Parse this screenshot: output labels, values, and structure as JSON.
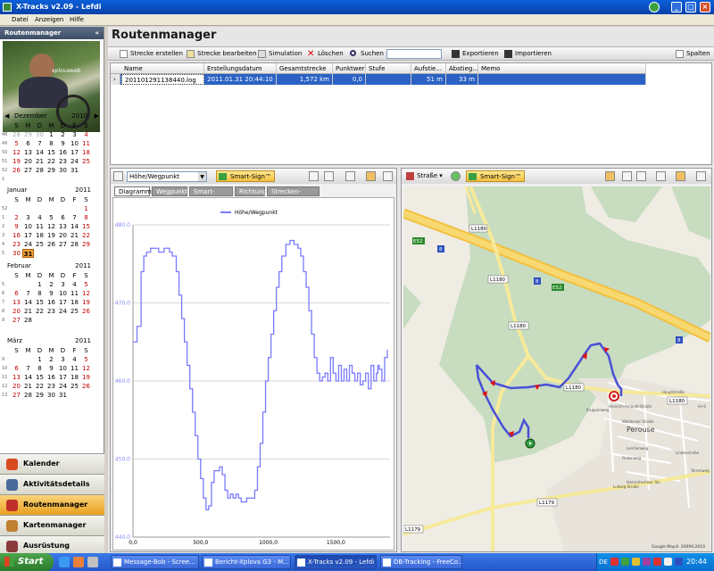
{
  "window": {
    "title": "X-Tracks v2.09 - Lefdi"
  },
  "menu": [
    "Datei",
    "Anzeigen",
    "Hilfe"
  ],
  "sidebar": {
    "title": "Routenmanager",
    "collapse": "«",
    "photo_caption": "xplovaweb",
    "weekday_headers": [
      "S",
      "M",
      "D",
      "M",
      "D",
      "F",
      "S"
    ],
    "calendars": [
      {
        "month": "Dezember",
        "year": "2010",
        "nav": true,
        "weeks": [
          "48",
          "49",
          "50",
          "51",
          "52",
          "1"
        ],
        "days": [
          [
            "28",
            "gray"
          ],
          [
            "29",
            "gray"
          ],
          [
            "30",
            "gray"
          ],
          [
            "1",
            ""
          ],
          [
            "2",
            ""
          ],
          [
            "3",
            ""
          ],
          [
            "4",
            "red"
          ],
          [
            "5",
            "red"
          ],
          [
            "6",
            ""
          ],
          [
            "7",
            ""
          ],
          [
            "8",
            ""
          ],
          [
            "9",
            ""
          ],
          [
            "10",
            ""
          ],
          [
            "11",
            "red"
          ],
          [
            "12",
            "red"
          ],
          [
            "13",
            ""
          ],
          [
            "14",
            ""
          ],
          [
            "15",
            ""
          ],
          [
            "16",
            ""
          ],
          [
            "17",
            ""
          ],
          [
            "18",
            "red"
          ],
          [
            "19",
            "red"
          ],
          [
            "20",
            ""
          ],
          [
            "21",
            ""
          ],
          [
            "22",
            ""
          ],
          [
            "23",
            ""
          ],
          [
            "24",
            ""
          ],
          [
            "25",
            "red"
          ],
          [
            "26",
            "red"
          ],
          [
            "27",
            ""
          ],
          [
            "28",
            ""
          ],
          [
            "29",
            ""
          ],
          [
            "30",
            ""
          ],
          [
            "31",
            ""
          ],
          [
            "",
            ""
          ]
        ]
      },
      {
        "month": "Januar",
        "year": "2011",
        "nav": false,
        "weeks": [
          "52",
          "1",
          "2",
          "3",
          "4",
          "5"
        ],
        "days": [
          [
            "",
            ""
          ],
          [
            "",
            ""
          ],
          [
            "",
            ""
          ],
          [
            "",
            ""
          ],
          [
            "",
            ""
          ],
          [
            "",
            ""
          ],
          [
            "1",
            "red"
          ],
          [
            "2",
            "red"
          ],
          [
            "3",
            ""
          ],
          [
            "4",
            ""
          ],
          [
            "5",
            ""
          ],
          [
            "6",
            ""
          ],
          [
            "7",
            ""
          ],
          [
            "8",
            "red"
          ],
          [
            "9",
            "red"
          ],
          [
            "10",
            ""
          ],
          [
            "11",
            ""
          ],
          [
            "12",
            ""
          ],
          [
            "13",
            ""
          ],
          [
            "14",
            ""
          ],
          [
            "15",
            "red"
          ],
          [
            "16",
            "red"
          ],
          [
            "17",
            ""
          ],
          [
            "18",
            ""
          ],
          [
            "19",
            ""
          ],
          [
            "20",
            ""
          ],
          [
            "21",
            ""
          ],
          [
            "22",
            "red"
          ],
          [
            "23",
            "red"
          ],
          [
            "24",
            ""
          ],
          [
            "25",
            ""
          ],
          [
            "26",
            ""
          ],
          [
            "27",
            ""
          ],
          [
            "28",
            ""
          ],
          [
            "29",
            "red"
          ],
          [
            "30",
            "red"
          ],
          [
            "31",
            "today"
          ],
          [
            "",
            ""
          ],
          [
            "",
            ""
          ],
          [
            "",
            ""
          ],
          [
            "",
            ""
          ],
          [
            "",
            ""
          ]
        ]
      },
      {
        "month": "Februar",
        "year": "2011",
        "nav": false,
        "weeks": [
          "5",
          "6",
          "7",
          "8",
          "9"
        ],
        "days": [
          [
            "",
            ""
          ],
          [
            "",
            ""
          ],
          [
            "1",
            ""
          ],
          [
            "2",
            ""
          ],
          [
            "3",
            ""
          ],
          [
            "4",
            ""
          ],
          [
            "5",
            "red"
          ],
          [
            "6",
            "red"
          ],
          [
            "7",
            ""
          ],
          [
            "8",
            ""
          ],
          [
            "9",
            ""
          ],
          [
            "10",
            ""
          ],
          [
            "11",
            ""
          ],
          [
            "12",
            "red"
          ],
          [
            "13",
            "red"
          ],
          [
            "14",
            ""
          ],
          [
            "15",
            ""
          ],
          [
            "16",
            ""
          ],
          [
            "17",
            ""
          ],
          [
            "18",
            ""
          ],
          [
            "19",
            "red"
          ],
          [
            "20",
            "red"
          ],
          [
            "21",
            ""
          ],
          [
            "22",
            ""
          ],
          [
            "23",
            ""
          ],
          [
            "24",
            ""
          ],
          [
            "25",
            ""
          ],
          [
            "26",
            "red"
          ],
          [
            "27",
            "red"
          ],
          [
            "28",
            ""
          ],
          [
            "",
            ""
          ],
          [
            "",
            ""
          ],
          [
            "",
            ""
          ],
          [
            "",
            ""
          ],
          [
            "",
            ""
          ]
        ]
      },
      {
        "month": "März",
        "year": "2011",
        "nav": false,
        "weeks": [
          "9",
          "10",
          "11",
          "12",
          "13"
        ],
        "days": [
          [
            "",
            ""
          ],
          [
            "",
            ""
          ],
          [
            "1",
            ""
          ],
          [
            "2",
            ""
          ],
          [
            "3",
            ""
          ],
          [
            "4",
            ""
          ],
          [
            "5",
            "red"
          ],
          [
            "6",
            "red"
          ],
          [
            "7",
            ""
          ],
          [
            "8",
            ""
          ],
          [
            "9",
            ""
          ],
          [
            "10",
            ""
          ],
          [
            "11",
            ""
          ],
          [
            "12",
            "red"
          ],
          [
            "13",
            "red"
          ],
          [
            "14",
            ""
          ],
          [
            "15",
            ""
          ],
          [
            "16",
            ""
          ],
          [
            "17",
            ""
          ],
          [
            "18",
            ""
          ],
          [
            "19",
            "red"
          ],
          [
            "20",
            "red"
          ],
          [
            "21",
            ""
          ],
          [
            "22",
            ""
          ],
          [
            "23",
            ""
          ],
          [
            "24",
            ""
          ],
          [
            "25",
            ""
          ],
          [
            "26",
            "red"
          ],
          [
            "27",
            "red"
          ],
          [
            "28",
            ""
          ],
          [
            "29",
            ""
          ],
          [
            "30",
            ""
          ],
          [
            "31",
            ""
          ],
          [
            "",
            ""
          ],
          [
            "",
            ""
          ]
        ]
      }
    ],
    "nav": [
      {
        "label": "Kalender",
        "icon": "calendar-icon",
        "color": "#d84a20"
      },
      {
        "label": "Aktivitätsdetails",
        "icon": "activity-icon",
        "color": "#4a6a9a"
      },
      {
        "label": "Routenmanager",
        "icon": "route-icon",
        "color": "#c0302a",
        "active": true
      },
      {
        "label": "Kartenmanager",
        "icon": "map-icon",
        "color": "#c08030"
      },
      {
        "label": "Ausrüstung",
        "icon": "equipment-icon",
        "color": "#8a3a3a"
      }
    ]
  },
  "main": {
    "title": "Routenmanager",
    "toolbar": {
      "create": "Strecke erstellen",
      "edit": "Strecke bearbeiten",
      "simulation": "Simulation",
      "delete": "Löschen",
      "search": "Suchen",
      "search_value": "",
      "export": "Exportieren",
      "import": "Importieren",
      "columns": "Spalten"
    },
    "table": {
      "columns": [
        "Name",
        "Erstellungsdatum",
        "Gesamtstrecke",
        "Punktwert",
        "Stufe",
        "Aufstie...",
        "Abstieg...",
        "Memo"
      ],
      "rows": [
        [
          "201101291138440.log",
          "2011.01.31 20:44:10",
          "1,572 km",
          "0,0",
          "",
          "51 m",
          "33 m",
          ""
        ]
      ]
    }
  },
  "elevation": {
    "selector": "Höhe/Wegpunkt",
    "smart_sign": "Smart-Sign™",
    "tabs": [
      "Diagramm",
      "Wegpunkt",
      "Smart-Sign™",
      "Richtung",
      "Strecken-Memo"
    ]
  },
  "chart_data": {
    "type": "line",
    "legend": "Höhe/Wegpunkt",
    "legend_position": "top-center",
    "xlim": [
      0,
      1900
    ],
    "ylim": [
      440,
      480
    ],
    "x_ticks": [
      "0,0",
      "500,0",
      "1000,0",
      "1500,0"
    ],
    "y_ticks": [
      "440,0",
      "450,0",
      "460,0",
      "470,0",
      "480,0"
    ],
    "grid": "horizontal",
    "color": "#7a7aff",
    "series": [
      {
        "x": [
          0,
          30,
          60,
          80,
          100,
          130,
          160,
          190,
          210,
          230,
          250,
          270,
          290,
          320,
          340,
          360,
          380,
          400,
          420,
          440,
          460,
          480,
          500,
          520,
          540,
          560,
          580,
          600,
          620,
          640,
          660,
          680,
          700,
          720,
          740,
          760,
          780,
          800,
          820,
          840,
          860,
          880,
          900,
          920,
          940,
          960,
          980,
          1000,
          1020,
          1040,
          1060,
          1080,
          1100,
          1130,
          1160,
          1190,
          1220,
          1240,
          1260,
          1280,
          1300,
          1320,
          1340,
          1360,
          1380,
          1400,
          1420,
          1440,
          1460,
          1480,
          1500,
          1520,
          1540,
          1560,
          1580,
          1600,
          1620,
          1640,
          1660,
          1680,
          1700,
          1720,
          1740,
          1760,
          1780,
          1800,
          1810,
          1820,
          1840,
          1860,
          1880
        ],
        "y": [
          465,
          467,
          474,
          476,
          476.5,
          477,
          477,
          476.5,
          476.5,
          477,
          477,
          476.5,
          476,
          474,
          471,
          468,
          465,
          462,
          459,
          456,
          453,
          450,
          447.5,
          445,
          443.5,
          444,
          447,
          448.5,
          448.5,
          449,
          448,
          446,
          445,
          445.5,
          445,
          445.5,
          445,
          444.5,
          444.5,
          445,
          445,
          445,
          446,
          449,
          452,
          456,
          460,
          463,
          466,
          469,
          472,
          474,
          476,
          477.5,
          478,
          477.5,
          477,
          476,
          474,
          472,
          469,
          466,
          463,
          461,
          460,
          460.5,
          461,
          460,
          463,
          461,
          460,
          462,
          460,
          461.5,
          460,
          462,
          461,
          460,
          461,
          459.5,
          460,
          461,
          459,
          462,
          460,
          461,
          462,
          461.5,
          460,
          463,
          464
        ]
      }
    ]
  },
  "map": {
    "layer": "Straße",
    "smart_sign": "Smart-Sign™",
    "road_labels": [
      "L1180",
      "E52",
      "8",
      "L1180",
      "8",
      "E52",
      "L1180",
      "8",
      "L1180",
      "L1180",
      "L1179",
      "L1179"
    ],
    "town": "Perouse",
    "streets": [
      "Heinrich-Arnauld-Straße",
      "Hauptstraße",
      "Waldenser Straße",
      "Lerchenweg",
      "Finkenweg",
      "Heimsheimer Str.",
      "Kruppenweg",
      "Ludwig-Straße",
      "Lindenstraße",
      "Terrenweg",
      "H+S"
    ],
    "copyright": "Google Map© 2009",
    "copyright_extra": "©2010",
    "route_color": "#4a50d8"
  },
  "taskbar": {
    "start": "Start",
    "tasks": [
      {
        "label": "Message-Bob - Scree...",
        "active": false
      },
      {
        "label": "Bericht-Xplova G3 - M...",
        "active": false
      },
      {
        "label": "X-Tracks v2.09 - Lefdi",
        "active": true
      },
      {
        "label": "DB-Tracking - FreeCo...",
        "active": false
      }
    ],
    "lang": "DE",
    "clock": "20:44"
  }
}
